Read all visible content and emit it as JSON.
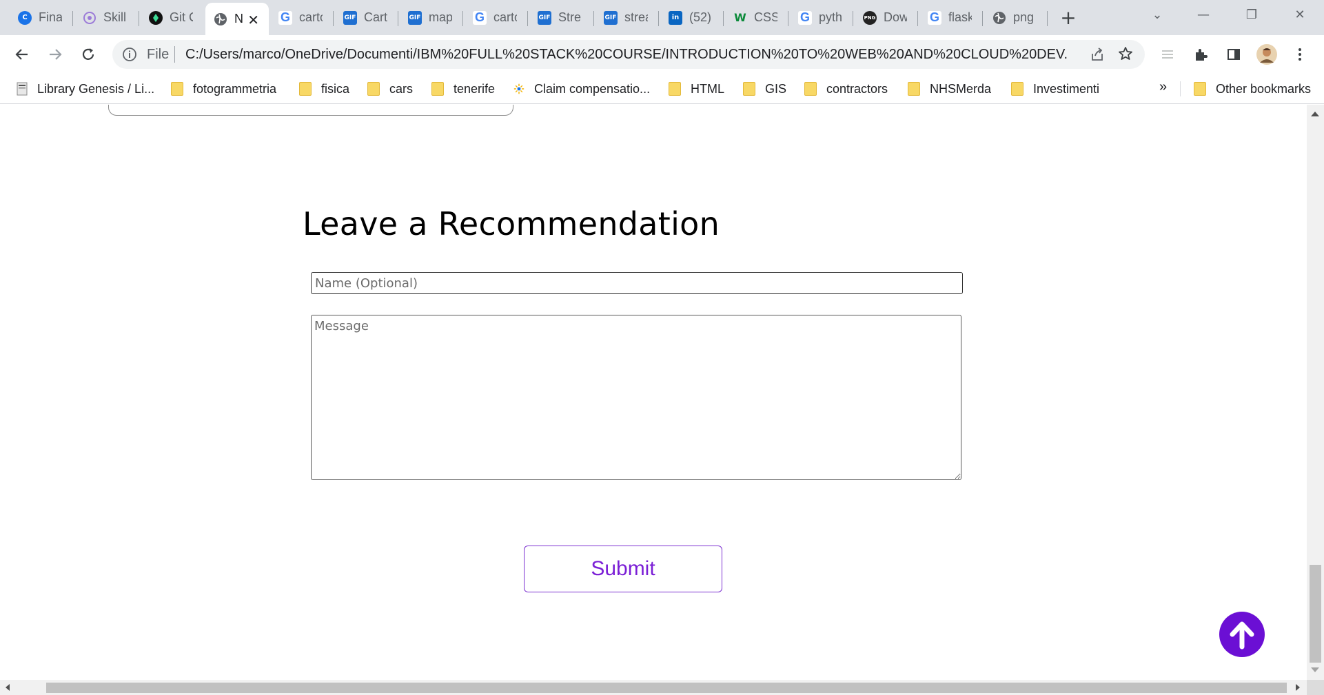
{
  "tabs": [
    {
      "title": "Fina",
      "favicon": "c-icon"
    },
    {
      "title": "Skill",
      "favicon": "skills-network-icon"
    },
    {
      "title": "Git C",
      "favicon": "git-icon"
    },
    {
      "title": "N",
      "favicon": "globe-icon",
      "active": true
    },
    {
      "title": "carto",
      "favicon": "google-icon"
    },
    {
      "title": "Cart",
      "favicon": "gif-icon"
    },
    {
      "title": "map",
      "favicon": "gif-icon"
    },
    {
      "title": "carto",
      "favicon": "google-icon"
    },
    {
      "title": "Stre",
      "favicon": "gif-icon"
    },
    {
      "title": "strea",
      "favicon": "gif-icon"
    },
    {
      "title": "(52)",
      "favicon": "linkedin-icon"
    },
    {
      "title": "CSS",
      "favicon": "w3schools-icon"
    },
    {
      "title": "pyth",
      "favicon": "google-icon"
    },
    {
      "title": "Dow",
      "favicon": "png-icon"
    },
    {
      "title": "flask",
      "favicon": "google-icon"
    },
    {
      "title": "png",
      "favicon": "globe-icon"
    }
  ],
  "tab_glyphs": {
    "gif": "GIF",
    "linkedin": "in",
    "w3": "W",
    "png": "PNG",
    "google": "G"
  },
  "active_tab_close": "✕",
  "new_tab_label": "+",
  "window_controls": {
    "tab_search": "⌄",
    "minimize": "—",
    "restore": "❐",
    "close": "✕"
  },
  "omnibox": {
    "scheme_label": "File",
    "url": "C:/Users/marco/OneDrive/Documenti/IBM%20FULL%20STACK%20COURSE/INTRODUCTION%20TO%20WEB%20AND%20CLOUD%20DEV..."
  },
  "bookmarks": [
    {
      "label": "Library Genesis / Li...",
      "icon": "book-icon"
    },
    {
      "label": "fotogrammetria",
      "icon": "folder-icon"
    },
    {
      "label": "fisica",
      "icon": "folder-icon"
    },
    {
      "label": "cars",
      "icon": "folder-icon"
    },
    {
      "label": "tenerife",
      "icon": "folder-icon"
    },
    {
      "label": "Claim compensatio...",
      "icon": "claim-icon"
    },
    {
      "label": "HTML",
      "icon": "folder-icon"
    },
    {
      "label": "GIS",
      "icon": "folder-icon"
    },
    {
      "label": "contractors",
      "icon": "folder-icon"
    },
    {
      "label": "NHSMerda",
      "icon": "folder-icon"
    },
    {
      "label": "Investimenti",
      "icon": "folder-icon"
    }
  ],
  "bookmarks_overflow": "»",
  "other_bookmarks": "Other bookmarks",
  "page": {
    "section_title": "Leave a Recommendation",
    "name_placeholder": "Name (Optional)",
    "message_placeholder": "Message",
    "submit_label": "Submit"
  },
  "colors": {
    "accent": "#6b0fd4",
    "submit_text": "#7b1fd6",
    "tabstrip_bg": "#dee1e6"
  }
}
